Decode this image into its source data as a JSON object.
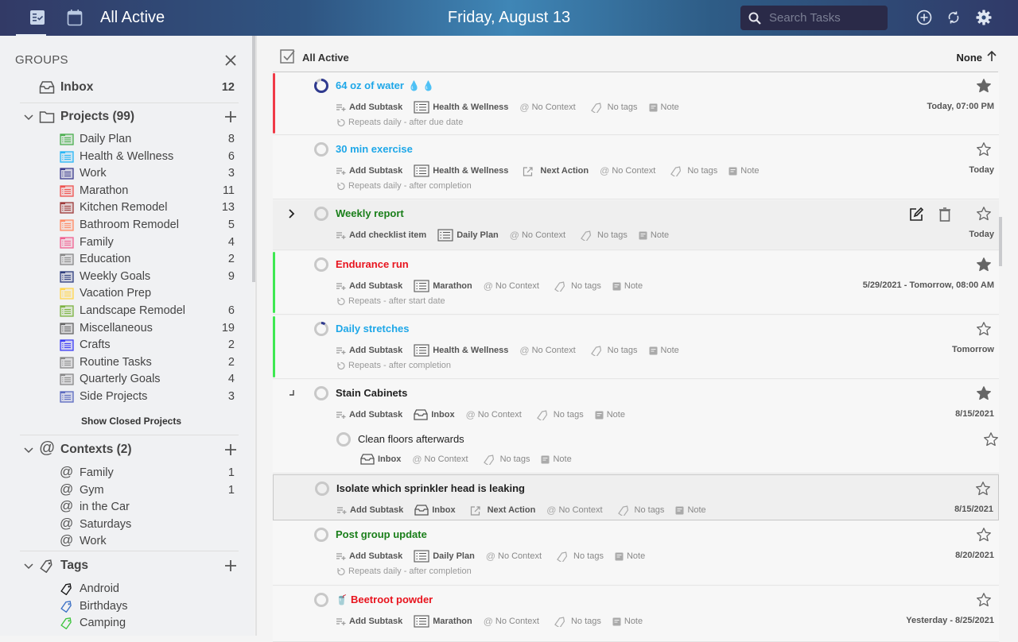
{
  "topbar": {
    "tabs": [
      {
        "name": "list-view",
        "icon": "checklist-icon",
        "active": true
      },
      {
        "name": "calendar-view",
        "icon": "calendar-icon",
        "active": false
      }
    ],
    "view_title": "All Active",
    "date": "Friday, August 13",
    "search_placeholder": "Search Tasks",
    "actions": [
      "add-task-icon",
      "sync-icon",
      "settings-icon"
    ]
  },
  "sidebar": {
    "heading": "GROUPS",
    "inbox": {
      "label": "Inbox",
      "count": "12"
    },
    "projects": {
      "label": "Projects (99)",
      "items": [
        {
          "label": "Daily Plan",
          "count": "8",
          "color": "#4caf50"
        },
        {
          "label": "Health & Wellness",
          "count": "6",
          "color": "#29b6f6"
        },
        {
          "label": "Work",
          "count": "3",
          "color": "#3f3f8f"
        },
        {
          "label": "Marathon",
          "count": "11",
          "color": "#ef5350"
        },
        {
          "label": "Kitchen Remodel",
          "count": "13",
          "color": "#9e3b3b"
        },
        {
          "label": "Bathroom Remodel",
          "count": "5",
          "color": "#ff8a65"
        },
        {
          "label": "Family",
          "count": "4",
          "color": "#f06292"
        },
        {
          "label": "Education",
          "count": "2",
          "color": "#888888"
        },
        {
          "label": "Weekly Goals",
          "count": "9",
          "color": "#303f7f"
        },
        {
          "label": "Vacation Prep",
          "count": "",
          "color": "#ffd54f"
        },
        {
          "label": "Landscape Remodel",
          "count": "6",
          "color": "#7cb342"
        },
        {
          "label": "Miscellaneous",
          "count": "19",
          "color": "#666666"
        },
        {
          "label": "Crafts",
          "count": "2",
          "color": "#3d3df5"
        },
        {
          "label": "Routine Tasks",
          "count": "2",
          "color": "#888888"
        },
        {
          "label": "Quarterly Goals",
          "count": "4",
          "color": "#888888"
        },
        {
          "label": "Side Projects",
          "count": "3",
          "color": "#5c6bc0"
        }
      ],
      "show_closed": "Show Closed Projects"
    },
    "contexts": {
      "label": "Contexts (2)",
      "items": [
        {
          "label": "Family",
          "count": "1"
        },
        {
          "label": "Gym",
          "count": "1"
        },
        {
          "label": "in the Car",
          "count": ""
        },
        {
          "label": "Saturdays",
          "count": ""
        },
        {
          "label": "Work",
          "count": ""
        }
      ]
    },
    "tags": {
      "label": "Tags",
      "items": [
        {
          "label": "Android",
          "color": "#111111"
        },
        {
          "label": "Birthdays",
          "color": "#3a6fc4"
        },
        {
          "label": "Camping",
          "color": "#3cc43c"
        }
      ]
    }
  },
  "list": {
    "title": "All Active",
    "sort_label": "None",
    "tasks": [
      {
        "name": "64 oz of water",
        "emoji": "💧 💧",
        "color": "#1ea7e8",
        "bar": "#f03a47",
        "add": "Add Subtask",
        "project": "Health & Wellness",
        "next_action": "",
        "context": "No Context",
        "tags": "No tags",
        "note": "Note",
        "repeat": "Repeats daily - after due date",
        "due": "Today, 07:00 PM",
        "starred": true,
        "progress": 0.85
      },
      {
        "name": "30 min exercise",
        "color": "#1ea7e8",
        "bar": "",
        "add": "Add Subtask",
        "project": "Health & Wellness",
        "next_action": "Next Action",
        "context": "No Context",
        "tags": "No tags",
        "note": "Note",
        "repeat": "Repeats daily - after completion",
        "due": "Today",
        "starred": false,
        "progress": 0
      },
      {
        "name": "Weekly report",
        "color": "#1a7f1a",
        "bar": "",
        "add": "Add checklist item",
        "project": "Daily Plan",
        "next_action": "",
        "context": "No Context",
        "tags": "No tags",
        "note": "Note",
        "repeat": "",
        "due": "Today",
        "starred": false,
        "progress": 0
      },
      {
        "name": "Endurance run",
        "color": "#e8141e",
        "bar": "#3ee851",
        "add": "Add Subtask",
        "project": "Marathon",
        "next_action": "",
        "context": "No Context",
        "tags": "No tags",
        "note": "Note",
        "repeat": "Repeats - after start date",
        "due": "5/29/2021 - Tomorrow, 08:00 AM",
        "starred": true,
        "progress": 0
      },
      {
        "name": "Daily stretches",
        "color": "#1ea7e8",
        "bar": "#3ee851",
        "add": "Add Subtask",
        "project": "Health & Wellness",
        "next_action": "",
        "context": "No Context",
        "tags": "No tags",
        "note": "Note",
        "repeat": "Repeats - after completion",
        "due": "Tomorrow",
        "starred": false,
        "progress": 0.1
      },
      {
        "name": "Stain Cabinets",
        "color": "#222222",
        "bar": "",
        "add": "Add Subtask",
        "project": "Inbox",
        "next_action": "",
        "context": "No Context",
        "tags": "No tags",
        "note": "Note",
        "repeat": "",
        "due": "8/15/2021",
        "starred": true,
        "progress": 0,
        "subtask": {
          "name": "Clean floors afterwards",
          "project": "Inbox",
          "context": "No Context",
          "tags": "No tags",
          "note": "Note",
          "starred": false
        }
      },
      {
        "name": "Isolate which sprinkler head is leaking",
        "color": "#222222",
        "bar": "",
        "add": "Add Subtask",
        "project": "Inbox",
        "next_action": "Next Action",
        "context": "No Context",
        "tags": "No tags",
        "note": "Note",
        "repeat": "",
        "due": "8/15/2021",
        "starred": false,
        "progress": 0
      },
      {
        "name": "Post group update",
        "color": "#1a7f1a",
        "bar": "",
        "add": "Add Subtask",
        "project": "Daily Plan",
        "next_action": "",
        "context": "No Context",
        "tags": "No tags",
        "note": "Note",
        "repeat": "Repeats daily - after completion",
        "due": "8/20/2021",
        "starred": false,
        "progress": 0
      },
      {
        "name": "Beetroot powder",
        "emoji_before": "🥤",
        "color": "#e8141e",
        "bar": "",
        "add": "Add Subtask",
        "project": "Marathon",
        "next_action": "",
        "context": "No Context",
        "tags": "No tags",
        "note": "Note",
        "repeat": "",
        "due": "Yesterday - 8/25/2021",
        "starred": false,
        "progress": 0
      }
    ]
  }
}
